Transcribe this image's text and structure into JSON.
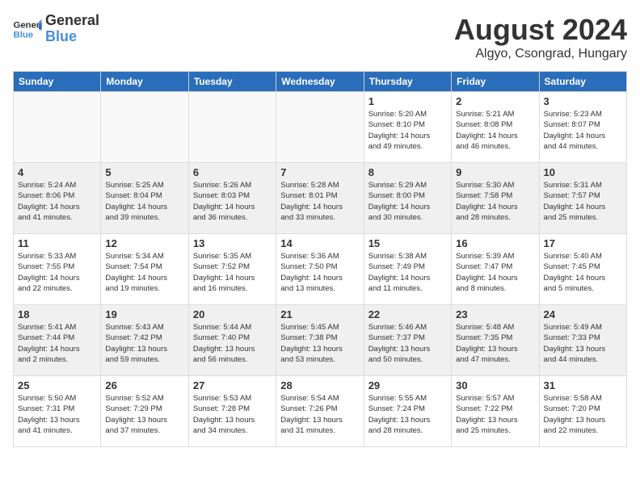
{
  "header": {
    "logo_line1": "General",
    "logo_line2": "Blue",
    "title": "August 2024",
    "subtitle": "Algyo, Csongrad, Hungary"
  },
  "weekdays": [
    "Sunday",
    "Monday",
    "Tuesday",
    "Wednesday",
    "Thursday",
    "Friday",
    "Saturday"
  ],
  "weeks": [
    [
      {
        "day": "",
        "info": ""
      },
      {
        "day": "",
        "info": ""
      },
      {
        "day": "",
        "info": ""
      },
      {
        "day": "",
        "info": ""
      },
      {
        "day": "1",
        "info": "Sunrise: 5:20 AM\nSunset: 8:10 PM\nDaylight: 14 hours\nand 49 minutes."
      },
      {
        "day": "2",
        "info": "Sunrise: 5:21 AM\nSunset: 8:08 PM\nDaylight: 14 hours\nand 46 minutes."
      },
      {
        "day": "3",
        "info": "Sunrise: 5:23 AM\nSunset: 8:07 PM\nDaylight: 14 hours\nand 44 minutes."
      }
    ],
    [
      {
        "day": "4",
        "info": "Sunrise: 5:24 AM\nSunset: 8:06 PM\nDaylight: 14 hours\nand 41 minutes."
      },
      {
        "day": "5",
        "info": "Sunrise: 5:25 AM\nSunset: 8:04 PM\nDaylight: 14 hours\nand 39 minutes."
      },
      {
        "day": "6",
        "info": "Sunrise: 5:26 AM\nSunset: 8:03 PM\nDaylight: 14 hours\nand 36 minutes."
      },
      {
        "day": "7",
        "info": "Sunrise: 5:28 AM\nSunset: 8:01 PM\nDaylight: 14 hours\nand 33 minutes."
      },
      {
        "day": "8",
        "info": "Sunrise: 5:29 AM\nSunset: 8:00 PM\nDaylight: 14 hours\nand 30 minutes."
      },
      {
        "day": "9",
        "info": "Sunrise: 5:30 AM\nSunset: 7:58 PM\nDaylight: 14 hours\nand 28 minutes."
      },
      {
        "day": "10",
        "info": "Sunrise: 5:31 AM\nSunset: 7:57 PM\nDaylight: 14 hours\nand 25 minutes."
      }
    ],
    [
      {
        "day": "11",
        "info": "Sunrise: 5:33 AM\nSunset: 7:55 PM\nDaylight: 14 hours\nand 22 minutes."
      },
      {
        "day": "12",
        "info": "Sunrise: 5:34 AM\nSunset: 7:54 PM\nDaylight: 14 hours\nand 19 minutes."
      },
      {
        "day": "13",
        "info": "Sunrise: 5:35 AM\nSunset: 7:52 PM\nDaylight: 14 hours\nand 16 minutes."
      },
      {
        "day": "14",
        "info": "Sunrise: 5:36 AM\nSunset: 7:50 PM\nDaylight: 14 hours\nand 13 minutes."
      },
      {
        "day": "15",
        "info": "Sunrise: 5:38 AM\nSunset: 7:49 PM\nDaylight: 14 hours\nand 11 minutes."
      },
      {
        "day": "16",
        "info": "Sunrise: 5:39 AM\nSunset: 7:47 PM\nDaylight: 14 hours\nand 8 minutes."
      },
      {
        "day": "17",
        "info": "Sunrise: 5:40 AM\nSunset: 7:45 PM\nDaylight: 14 hours\nand 5 minutes."
      }
    ],
    [
      {
        "day": "18",
        "info": "Sunrise: 5:41 AM\nSunset: 7:44 PM\nDaylight: 14 hours\nand 2 minutes."
      },
      {
        "day": "19",
        "info": "Sunrise: 5:43 AM\nSunset: 7:42 PM\nDaylight: 13 hours\nand 59 minutes."
      },
      {
        "day": "20",
        "info": "Sunrise: 5:44 AM\nSunset: 7:40 PM\nDaylight: 13 hours\nand 56 minutes."
      },
      {
        "day": "21",
        "info": "Sunrise: 5:45 AM\nSunset: 7:38 PM\nDaylight: 13 hours\nand 53 minutes."
      },
      {
        "day": "22",
        "info": "Sunrise: 5:46 AM\nSunset: 7:37 PM\nDaylight: 13 hours\nand 50 minutes."
      },
      {
        "day": "23",
        "info": "Sunrise: 5:48 AM\nSunset: 7:35 PM\nDaylight: 13 hours\nand 47 minutes."
      },
      {
        "day": "24",
        "info": "Sunrise: 5:49 AM\nSunset: 7:33 PM\nDaylight: 13 hours\nand 44 minutes."
      }
    ],
    [
      {
        "day": "25",
        "info": "Sunrise: 5:50 AM\nSunset: 7:31 PM\nDaylight: 13 hours\nand 41 minutes."
      },
      {
        "day": "26",
        "info": "Sunrise: 5:52 AM\nSunset: 7:29 PM\nDaylight: 13 hours\nand 37 minutes."
      },
      {
        "day": "27",
        "info": "Sunrise: 5:53 AM\nSunset: 7:28 PM\nDaylight: 13 hours\nand 34 minutes."
      },
      {
        "day": "28",
        "info": "Sunrise: 5:54 AM\nSunset: 7:26 PM\nDaylight: 13 hours\nand 31 minutes."
      },
      {
        "day": "29",
        "info": "Sunrise: 5:55 AM\nSunset: 7:24 PM\nDaylight: 13 hours\nand 28 minutes."
      },
      {
        "day": "30",
        "info": "Sunrise: 5:57 AM\nSunset: 7:22 PM\nDaylight: 13 hours\nand 25 minutes."
      },
      {
        "day": "31",
        "info": "Sunrise: 5:58 AM\nSunset: 7:20 PM\nDaylight: 13 hours\nand 22 minutes."
      }
    ]
  ]
}
